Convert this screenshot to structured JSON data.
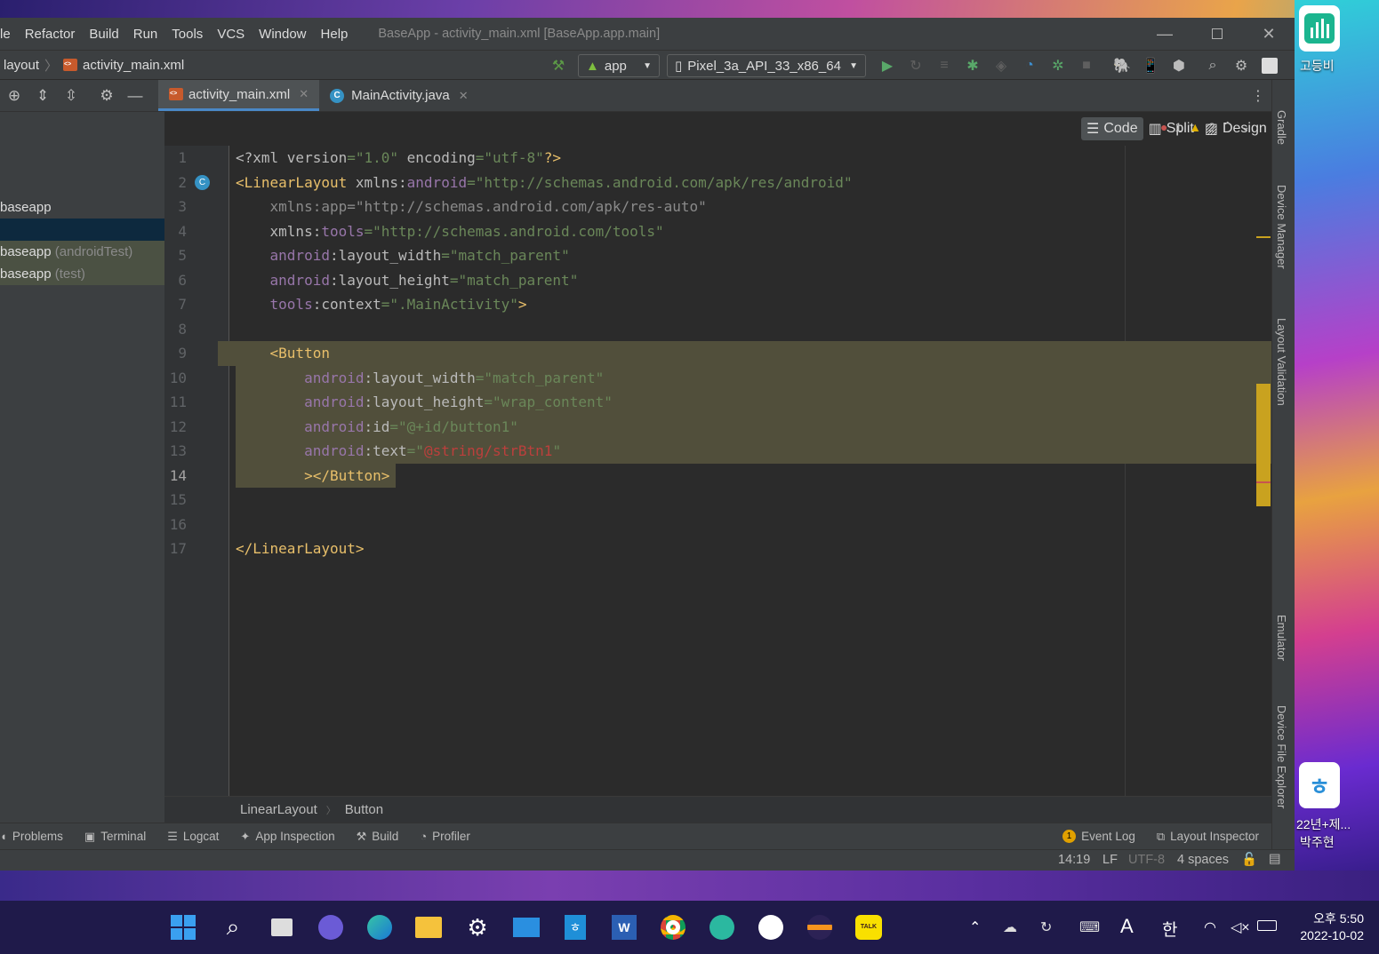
{
  "window": {
    "title": "BaseApp - activity_main.xml [BaseApp.app.main]",
    "menu": [
      "le",
      "Refactor",
      "Build",
      "Run",
      "Tools",
      "VCS",
      "Window",
      "Help"
    ]
  },
  "navbar": {
    "crumbs": [
      "layout",
      "activity_main.xml"
    ],
    "run_config": "app",
    "device": "Pixel_3a_API_33_x86_64"
  },
  "tabs": [
    {
      "label": "activity_main.xml",
      "active": true
    },
    {
      "label": "MainActivity.java",
      "active": false
    }
  ],
  "view_modes": {
    "code": "Code",
    "split": "Split",
    "design": "Design"
  },
  "inspection": {
    "errors": "1",
    "warnings": "2"
  },
  "project_tree": [
    {
      "label": "baseapp",
      "suffix": ""
    },
    {
      "label": "baseapp",
      "suffix": "(androidTest)"
    },
    {
      "label": "baseapp",
      "suffix": "(test)"
    }
  ],
  "code": {
    "line_numbers": [
      "1",
      "2",
      "3",
      "4",
      "5",
      "6",
      "7",
      "8",
      "9",
      "10",
      "11",
      "12",
      "13",
      "14",
      "15",
      "16",
      "17"
    ],
    "lines": [
      "<?xml version=\"1.0\" encoding=\"utf-8\"?>",
      "<LinearLayout xmlns:android=\"http://schemas.android.com/apk/res/android\"",
      "    xmlns:app=\"http://schemas.android.com/apk/res-auto\"",
      "    xmlns:tools=\"http://schemas.android.com/tools\"",
      "    android:layout_width=\"match_parent\"",
      "    android:layout_height=\"match_parent\"",
      "    tools:context=\".MainActivity\">",
      "",
      "    <Button",
      "        android:layout_width=\"match_parent\"",
      "        android:layout_height=\"wrap_content\"",
      "        android:id=\"@+id/button1\"",
      "        android:text=\"@string/strBtn1\"",
      "        ></Button>",
      "",
      "",
      "</LinearLayout>"
    ]
  },
  "editor_breadcrumb": [
    "LinearLayout",
    "Button"
  ],
  "right_tools": [
    "Gradle",
    "Device Manager",
    "Layout Validation",
    "Emulator",
    "Device File Explorer"
  ],
  "bottom_tools": [
    "Problems",
    "Terminal",
    "Logcat",
    "App Inspection",
    "Build",
    "Profiler",
    "Event Log",
    "Layout Inspector"
  ],
  "event_log_count": "1",
  "status": {
    "position": "14:19",
    "line_sep": "LF",
    "encoding": "UTF-8",
    "indent": "4 spaces"
  },
  "desktop": {
    "icon1_label": "고등비",
    "icon2_label_line1": "22년+제...",
    "icon2_label_line2": "박주현"
  },
  "tray": {
    "ime_a": "A",
    "ime_han": "한",
    "time": "오후 5:50",
    "date": "2022-10-02"
  },
  "colors": {
    "tag": "#e8bf6a",
    "namespace": "#9876aa",
    "value": "#6a8759",
    "highlight": "#514f3b",
    "accent": "#4a88c7"
  }
}
